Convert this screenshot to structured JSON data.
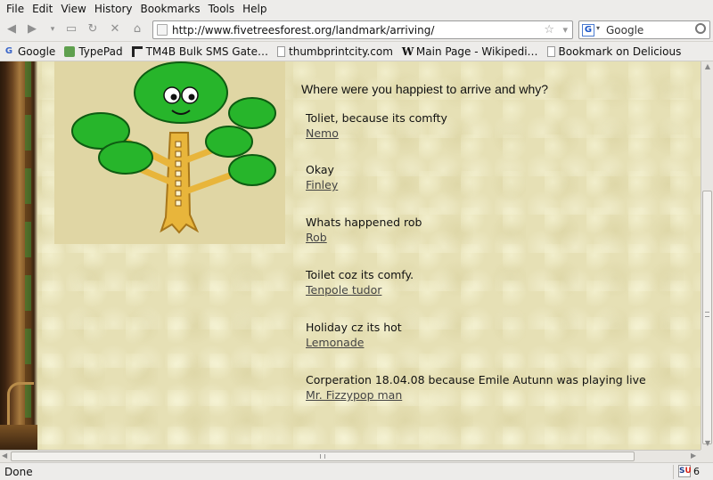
{
  "menu": [
    "File",
    "Edit",
    "View",
    "History",
    "Bookmarks",
    "Tools",
    "Help"
  ],
  "nav": {
    "back_icon": "back-arrow-icon",
    "forward_icon": "forward-arrow-icon",
    "url": "http://www.fivetreesforest.org/landmark/arriving/",
    "search_engine": "Google"
  },
  "bookmarks": [
    {
      "label": "Google",
      "icon": "google-icon"
    },
    {
      "label": "TypePad",
      "icon": "typepad-icon"
    },
    {
      "label": "TM4B Bulk SMS Gate…",
      "icon": "tm4b-icon"
    },
    {
      "label": "thumbprintcity.com",
      "icon": "page-icon"
    },
    {
      "label": "Main Page - Wikipedi…",
      "icon": "wikipedia-icon"
    },
    {
      "label": "Bookmark on Delicious",
      "icon": "page-icon"
    }
  ],
  "page": {
    "heading": "Where were you happiest to arrive and why?",
    "entries": [
      {
        "message": "Toliet, because its comfty",
        "author": "Nemo"
      },
      {
        "message": "Okay",
        "author": "Finley"
      },
      {
        "message": "Whats happened rob",
        "author": "Rob"
      },
      {
        "message": "Toilet coz its comfy.",
        "author": "Tenpole tudor"
      },
      {
        "message": "Holiday cz its hot",
        "author": "Lemonade"
      },
      {
        "message": "Corperation 18.04.08 because Emile Autunn was playing live",
        "author": "Mr. Fizzypop man"
      }
    ]
  },
  "status": {
    "text": "Done",
    "stumble_label": "SU",
    "count": "6"
  }
}
